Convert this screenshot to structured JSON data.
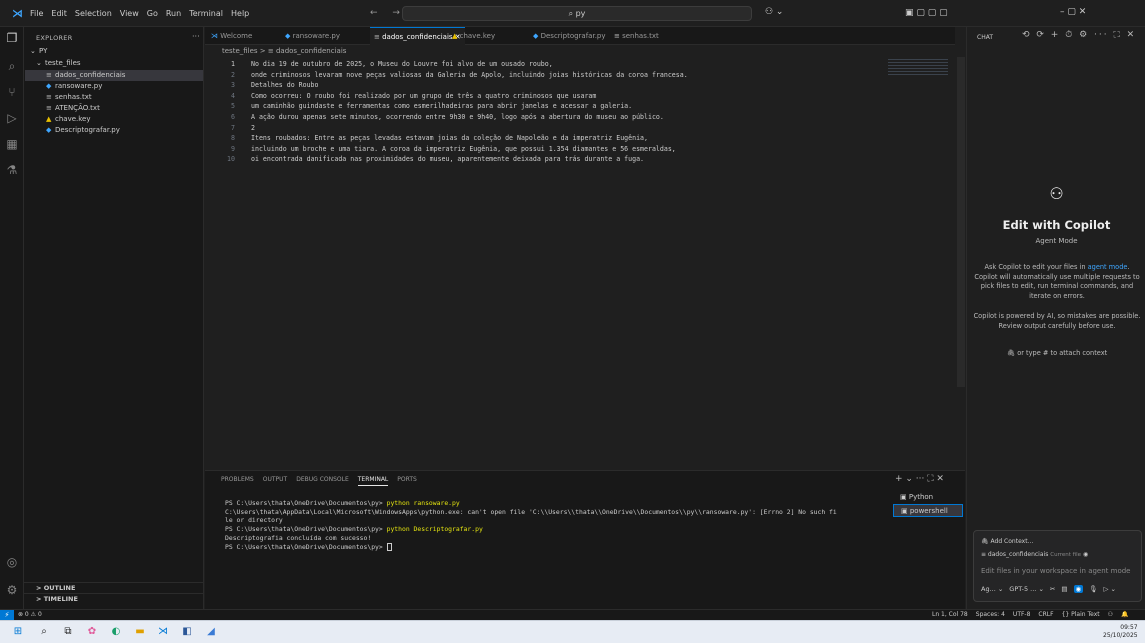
{
  "titlebar": {
    "menu": [
      "File",
      "Edit",
      "Selection",
      "View",
      "Go",
      "Run",
      "Terminal",
      "Help"
    ],
    "nav_arrows": "← →",
    "search_text": "⌕ py",
    "right_controls": "▣ ▢ ▢ ▢",
    "window_controls": "–  ▢  ✕"
  },
  "sidebar": {
    "title": "EXPLORER",
    "dots": "···",
    "root": "PY",
    "folder": "teste_files",
    "items": [
      {
        "icon": "≡",
        "label": "dados_confidenciais"
      },
      {
        "icon": "◆",
        "label": "ransoware.py"
      },
      {
        "icon": "≡",
        "label": "senhas.txt"
      },
      {
        "icon": "≡",
        "label": "ATENÇÃO.txt"
      },
      {
        "icon": "▲",
        "label": "chave.key"
      },
      {
        "icon": "◆",
        "label": "Descriptografar.py"
      }
    ],
    "outline": "> OUTLINE",
    "timeline": "> TIMELINE"
  },
  "tabs": [
    {
      "label": "Welcome",
      "active": false
    },
    {
      "label": "ransoware.py",
      "active": false
    },
    {
      "label": "dados_confidenciais ✕",
      "active": true
    },
    {
      "label": "chave.key",
      "active": false
    },
    {
      "label": "Descriptografar.py",
      "active": false
    },
    {
      "label": "senhas.txt",
      "active": false
    }
  ],
  "breadcrumb": "teste_files > ≡ dados_confidenciais",
  "editor": {
    "lines": [
      {
        "n": "1",
        "t": "No dia 19 de outubro de 2025, o Museu do Louvre foi alvo de um ousado roubo,"
      },
      {
        "n": "2",
        "t": "onde criminosos levaram nove peças valiosas da Galeria de Apolo, incluindo joias históricas da coroa francesa."
      },
      {
        "n": "3",
        "t": "Detalhes do Roubo"
      },
      {
        "n": "4",
        "t": "Como ocorreu: O roubo foi realizado por um grupo de três a quatro criminosos que usaram"
      },
      {
        "n": "5",
        "t": "um caminhão guindaste e ferramentas como esmerilhadeiras para abrir janelas e acessar a galeria."
      },
      {
        "n": "6",
        "t": "A ação durou apenas sete minutos, ocorrendo entre 9h30 e 9h40, logo após a abertura do museu ao público."
      },
      {
        "n": "7",
        "t": "2"
      },
      {
        "n": "8",
        "t": "Itens roubados: Entre as peças levadas estavam joias da coleção de Napoleão e da imperatriz Eugênia,"
      },
      {
        "n": "9",
        "t": "incluindo um broche e uma tiara. A coroa da imperatriz Eugênia, que possui 1.354 diamantes e 56 esmeraldas,"
      },
      {
        "n": "10",
        "t": "oi encontrada danificada nas proximidades do museu, aparentemente deixada para trás durante a fuga."
      }
    ]
  },
  "panel": {
    "tabs": [
      "PROBLEMS",
      "OUTPUT",
      "DEBUG CONSOLE",
      "TERMINAL",
      "PORTS"
    ],
    "active_tab": "TERMINAL",
    "controls": "+ ⌄ ··· ⛶ ✕",
    "terminal": {
      "l1_prompt": "PS C:\\Users\\thata\\OneDrive\\Documentos\\py> ",
      "l1_cmd": "python ransoware.py",
      "l2": "C:\\Users\\thata\\AppData\\Local\\Microsoft\\WindowsApps\\python.exe: can't open file 'C:\\\\Users\\\\thata\\\\OneDrive\\\\Documentos\\\\py\\\\ransoware.py': [Errno 2] No such fi",
      "l3": "le or directory",
      "l4_prompt": "PS C:\\Users\\thata\\OneDrive\\Documentos\\py> ",
      "l4_cmd": "python Descriptografar.py",
      "l5": "Descriptografia concluída com sucesso!",
      "l6_prompt": "PS C:\\Users\\thata\\OneDrive\\Documentos\\py> "
    },
    "terminals": [
      "Python",
      "powershell"
    ]
  },
  "chat": {
    "title": "CHAT",
    "controls": "⟲ ⟳ + ⏱ ⚙ ··· ⛶ ✕",
    "heading": "Edit with Copilot",
    "mode": "Agent Mode",
    "p1_a": "Ask Copilot to edit your files in ",
    "p1_link": "agent mode",
    "p1_b": ". Copilot will automatically use multiple requests to pick files to edit, run terminal commands, and iterate on errors.",
    "p2": "Copilot is powered by AI, so mistakes are possible. Review output carefully before use.",
    "p3": "or type # to attach context",
    "add_context": "Add Context...",
    "file_label": "≡ dados_confidenciais",
    "file_dim": "Current file",
    "placeholder": "Edit files in your workspace in agent mode",
    "tools_agent": "Ag... ⌄",
    "tools_model": "GPT-5 ... ⌄",
    "tools_send": "▷ ⌄"
  },
  "status": {
    "remote": "⚡",
    "errors": "⊗ 0 ⚠ 0",
    "position": "Ln 1, Col 78",
    "spaces": "Spaces: 4",
    "encoding": "UTF-8",
    "eol": "CRLF",
    "language": "{} Plain Text"
  },
  "clock": {
    "time": "09:57",
    "date": "25/10/2025"
  }
}
